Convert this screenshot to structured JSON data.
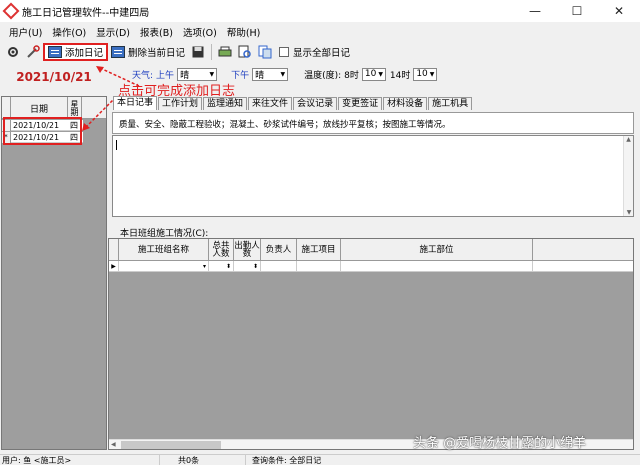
{
  "window": {
    "title": "施工日记管理软件--中建四局",
    "min_glyph": "—",
    "max_glyph": "☐",
    "close_glyph": "✕"
  },
  "menubar": [
    "用户(U)",
    "操作(O)",
    "显示(D)",
    "报表(B)",
    "选项(O)",
    "帮助(H)"
  ],
  "toolbar": {
    "add_label": "添加日记",
    "delete_label": "删除当前日记",
    "show_all_label": "显示全部日记",
    "icons": [
      "gear-icon",
      "tools-icon",
      "add-diary-icon",
      "delete-diary-icon",
      "save-icon",
      "print-icon",
      "preview-icon",
      "export-icon"
    ]
  },
  "left": {
    "current_date": "2021/10/21",
    "col_date": "日期",
    "col_week": "星期",
    "rows": [
      {
        "marker": "",
        "date": "2021/10/21",
        "week": "四"
      },
      {
        "marker": "*",
        "date": "2021/10/21",
        "week": "四"
      }
    ]
  },
  "annotation": "点击可完成添加日志",
  "weather": {
    "label": "天气:",
    "am_label": "上午",
    "am_value": "晴",
    "pm_label": "下午",
    "pm_value": "晴",
    "temp_label": "温度(度):",
    "t8_label": "8时",
    "t8_value": "10",
    "t14_label": "14时",
    "t14_value": "10"
  },
  "tabs": [
    "本日记事",
    "工作计划",
    "监理通知",
    "来往文件",
    "会议记录",
    "变更签证",
    "材料设备",
    "施工机具"
  ],
  "hint": "质量、安全、隐蔽工程验收；混凝土、砂浆试件编号；放线抄平复核；按图施工等情况。",
  "team_grid": {
    "title": "本日班组施工情况(C):",
    "headers": [
      "施工班组名称",
      "总共人数",
      "出勤人数",
      "负责人",
      "施工项目",
      "施工部位"
    ]
  },
  "statusbar": {
    "user": "用户: 鱼 <施工员>",
    "count": "共0条",
    "query": "查询条件: 全部日记"
  },
  "watermark": "头条 @爱喝杨枝甘露的小绵羊"
}
